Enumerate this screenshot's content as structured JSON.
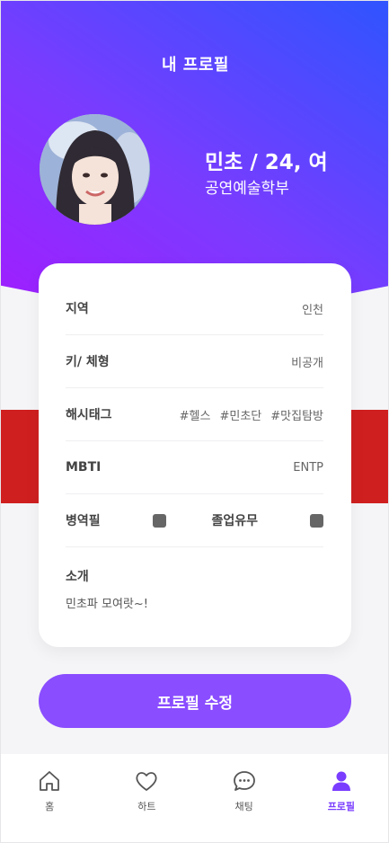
{
  "header": {
    "title": "내 프로필"
  },
  "profile": {
    "name_age_gender": "민초 / 24, 여",
    "department": "공연예술학부"
  },
  "details": {
    "region": {
      "label": "지역",
      "value": "인천"
    },
    "height_body": {
      "label": "키/ 체형",
      "value": "비공개"
    },
    "hashtags": {
      "label": "해시태그",
      "tags": [
        "#헬스",
        "#민초단",
        "#맛집탐방"
      ]
    },
    "mbti": {
      "label": "MBTI",
      "value": "ENTP"
    },
    "military": {
      "label": "병역필"
    },
    "graduated": {
      "label": "졸업유무"
    },
    "intro": {
      "label": "소개",
      "text": "민초파 모여랏~!"
    }
  },
  "edit_button": "프로필 수정",
  "nav": {
    "items": [
      {
        "label": "홈",
        "icon": "home-icon"
      },
      {
        "label": "하트",
        "icon": "heart-icon"
      },
      {
        "label": "채팅",
        "icon": "chat-icon"
      },
      {
        "label": "프로필",
        "icon": "person-icon",
        "active": true
      }
    ]
  },
  "colors": {
    "gradient_start": "#a21cff",
    "gradient_end": "#2f54ff",
    "accent": "#8a4dff",
    "red_band": "#cf1f1f",
    "active_nav": "#7a3dff"
  }
}
